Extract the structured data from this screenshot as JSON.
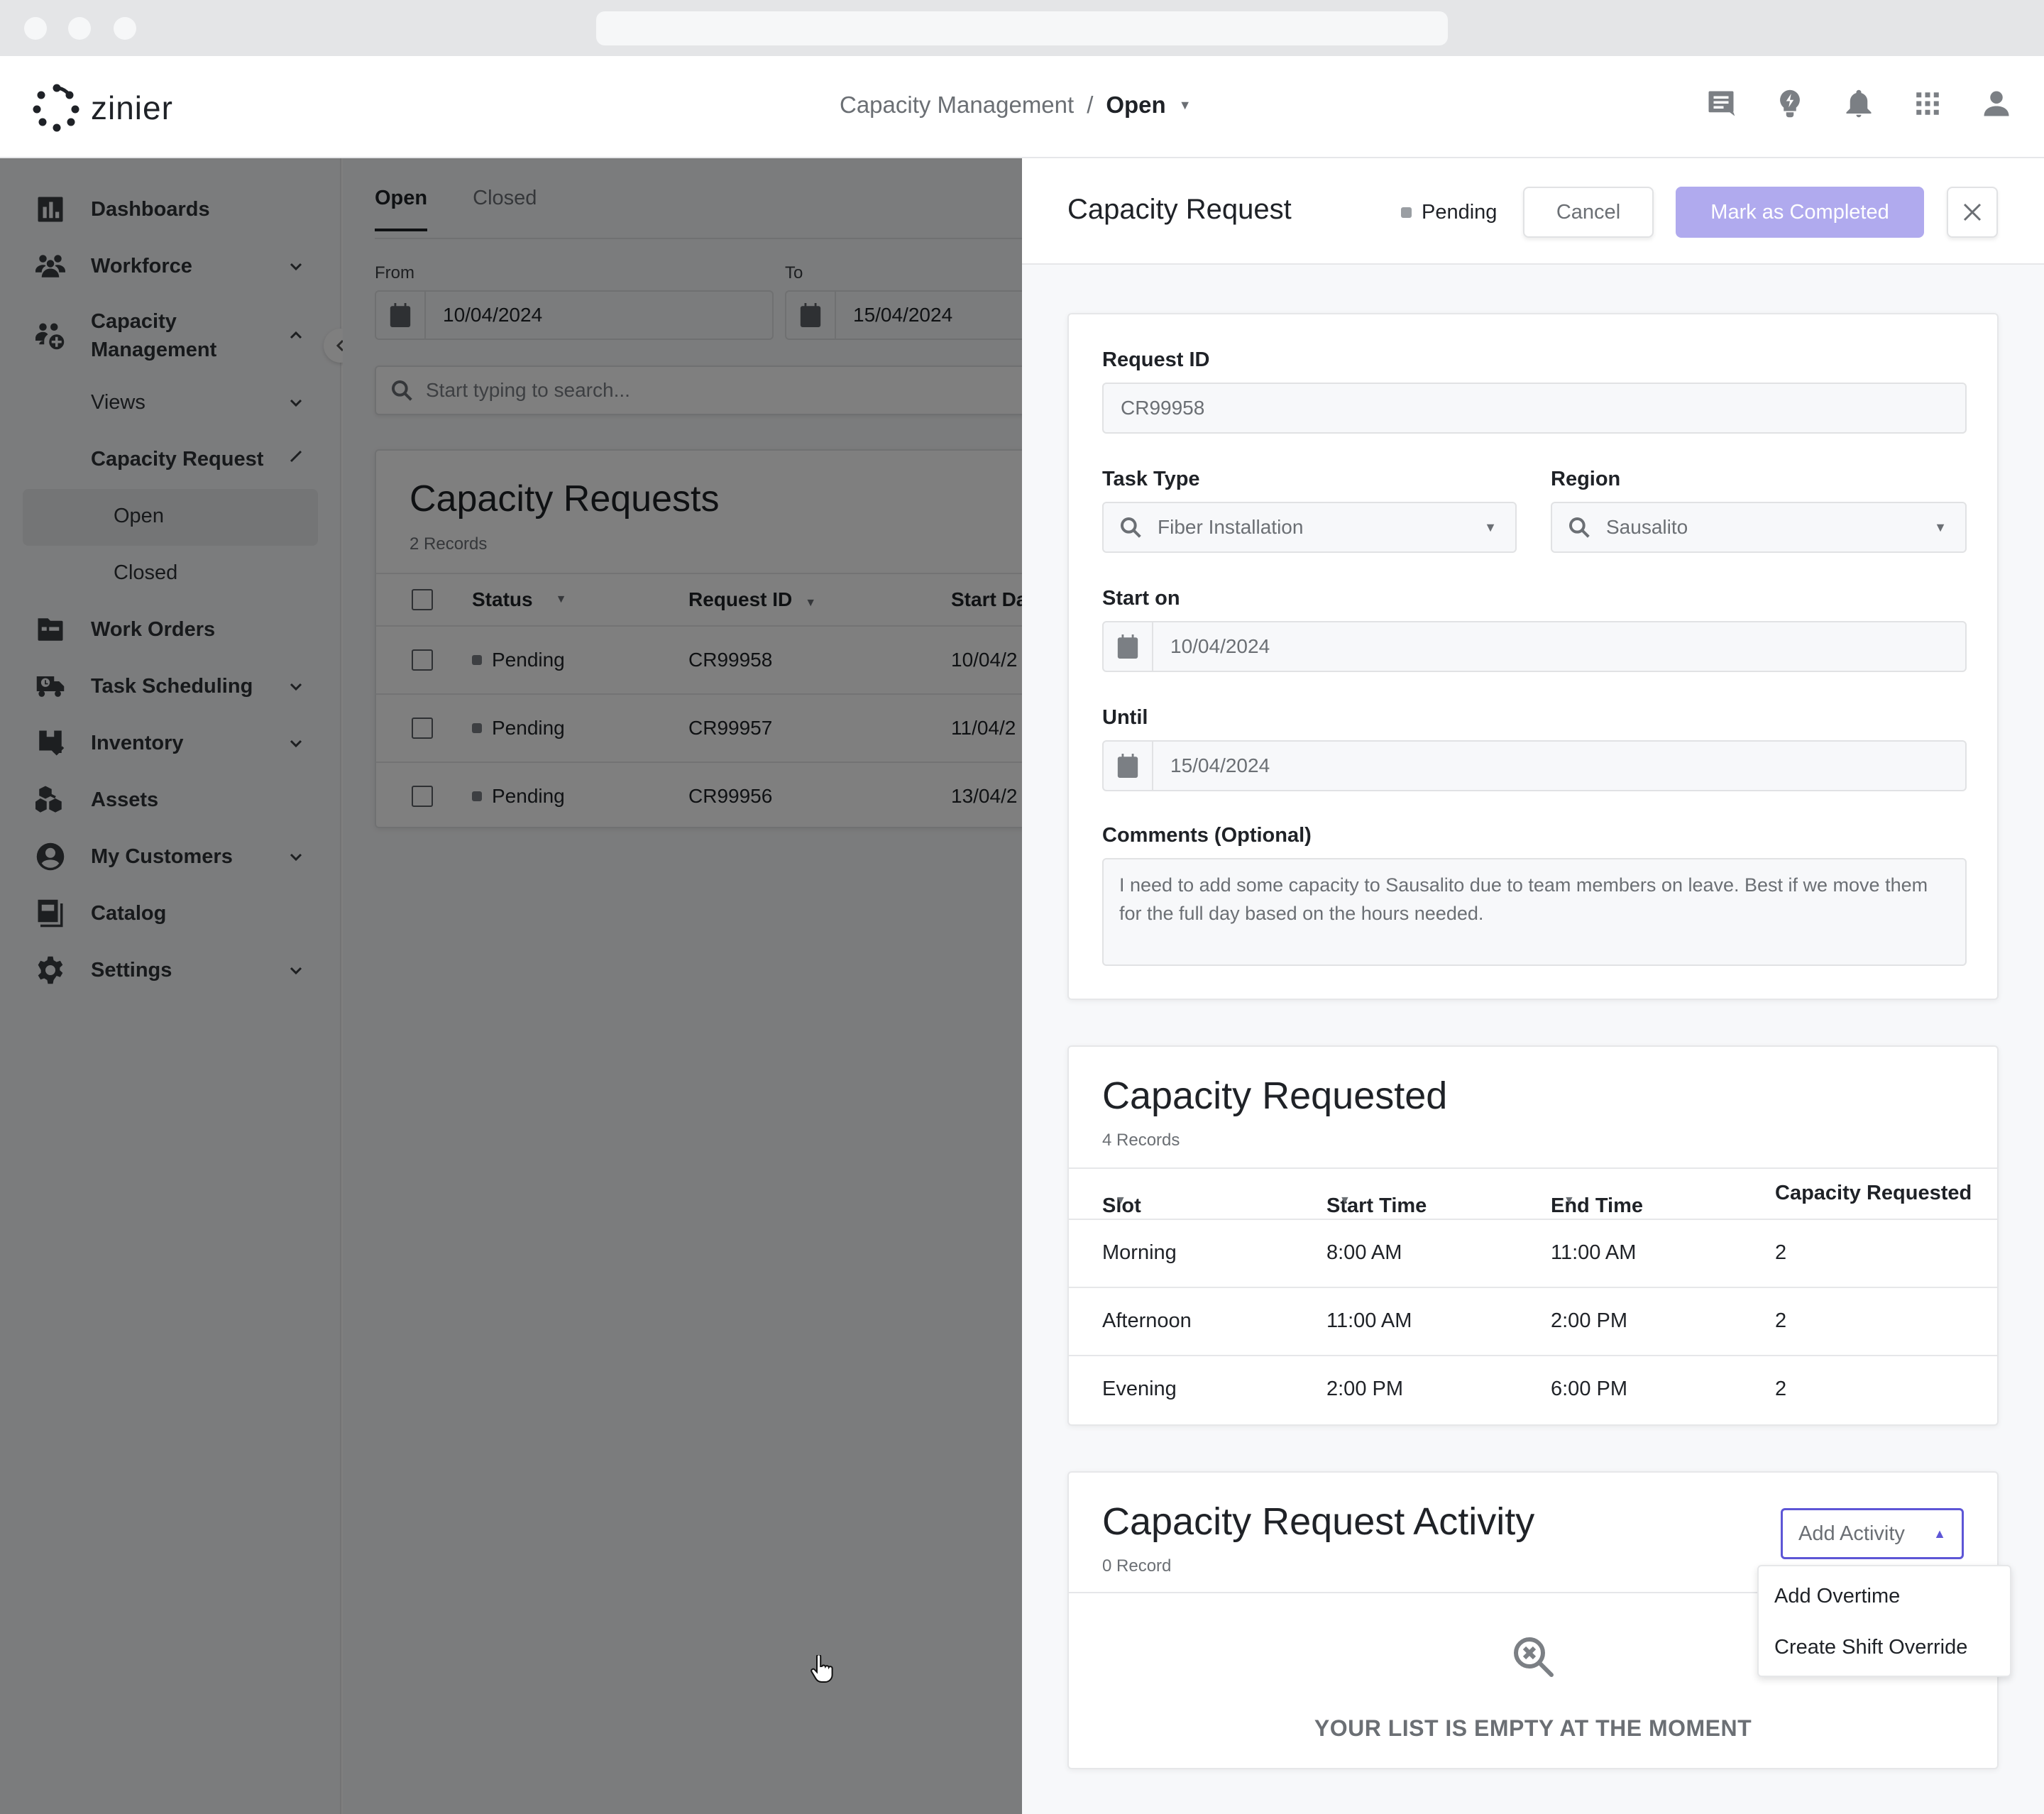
{
  "app": {
    "brand": "zinier",
    "breadcrumb": {
      "parent": "Capacity Management",
      "separator": "/",
      "current": "Open"
    },
    "header_icons": [
      "chat-icon",
      "lightbulb-icon",
      "bell-icon",
      "apps-grid-icon",
      "user-icon"
    ]
  },
  "sidebar": {
    "items": [
      {
        "label": "Dashboards",
        "icon": "dashboard-icon",
        "expandable": false
      },
      {
        "label": "Workforce",
        "icon": "workforce-icon",
        "expandable": true,
        "expanded": false
      },
      {
        "label": "Capacity Management",
        "icon": "capacity-management-icon",
        "expandable": true,
        "expanded": true
      },
      {
        "label": "Views",
        "expandable": true,
        "expanded": false,
        "level": 1
      },
      {
        "label": "Capacity Request",
        "expandable": true,
        "expanded": true,
        "level": 1
      },
      {
        "label": "Open",
        "level": 2,
        "active": true
      },
      {
        "label": "Closed",
        "level": 2
      },
      {
        "label": "Work Orders",
        "icon": "work-orders-icon",
        "expandable": false
      },
      {
        "label": "Task Scheduling",
        "icon": "truck-clock-icon",
        "expandable": true
      },
      {
        "label": "Inventory",
        "icon": "inventory-icon",
        "expandable": true
      },
      {
        "label": "Assets",
        "icon": "assets-cubes-icon",
        "expandable": false
      },
      {
        "label": "My Customers",
        "icon": "customer-icon",
        "expandable": true
      },
      {
        "label": "Catalog",
        "icon": "catalog-icon",
        "expandable": false
      },
      {
        "label": "Settings",
        "icon": "gear-icon",
        "expandable": true
      }
    ]
  },
  "main": {
    "tabs": [
      {
        "label": "Open",
        "active": true
      },
      {
        "label": "Closed",
        "active": false
      }
    ],
    "filters": {
      "from_label": "From",
      "from_value": "10/04/2024",
      "to_label": "To",
      "to_value": "15/04/2024",
      "search_placeholder": "Start typing to search..."
    },
    "list": {
      "title": "Capacity Requests",
      "record_count": "2 Records",
      "columns": [
        "Status",
        "Request ID",
        "Start Da"
      ],
      "rows": [
        {
          "status": "Pending",
          "request_id": "CR99958",
          "start_date": "10/04/2"
        },
        {
          "status": "Pending",
          "request_id": "CR99957",
          "start_date": "11/04/2"
        },
        {
          "status": "Pending",
          "request_id": "CR99956",
          "start_date": "13/04/2"
        }
      ]
    }
  },
  "panel": {
    "title": "Capacity Request",
    "status": "Pending",
    "cancel_label": "Cancel",
    "complete_label": "Mark as Completed",
    "colors": {
      "accent": "#5d56d6",
      "complete_button": "#b0aaee",
      "status_dot": "#9a9ea3"
    },
    "form": {
      "request_id_label": "Request ID",
      "request_id_value": "CR99958",
      "task_type_label": "Task Type",
      "task_type_value": "Fiber Installation",
      "region_label": "Region",
      "region_value": "Sausalito",
      "start_label": "Start on",
      "start_value": "10/04/2024",
      "until_label": "Until",
      "until_value": "15/04/2024",
      "comments_label": "Comments (Optional)",
      "comments_value": "I need to add some capacity to Sausalito due to team members on leave. Best if we move them for the full day based on the hours needed."
    },
    "capacity": {
      "title": "Capacity Requested",
      "record_count": "4 Records",
      "columns": [
        "Slot",
        "Start Time",
        "End Time",
        "Capacity Requested"
      ],
      "rows": [
        {
          "slot": "Morning",
          "start": "8:00 AM",
          "end": "11:00 AM",
          "capacity": "2"
        },
        {
          "slot": "Afternoon",
          "start": "11:00 AM",
          "end": "2:00 PM",
          "capacity": "2"
        },
        {
          "slot": "Evening",
          "start": "2:00 PM",
          "end": "6:00 PM",
          "capacity": "2"
        }
      ]
    },
    "activity": {
      "title": "Capacity Request Activity",
      "record_count": "0 Record",
      "add_label": "Add Activity",
      "menu": [
        "Add Overtime",
        "Create Shift Override"
      ],
      "empty_text": "YOUR LIST IS EMPTY AT THE MOMENT"
    }
  }
}
